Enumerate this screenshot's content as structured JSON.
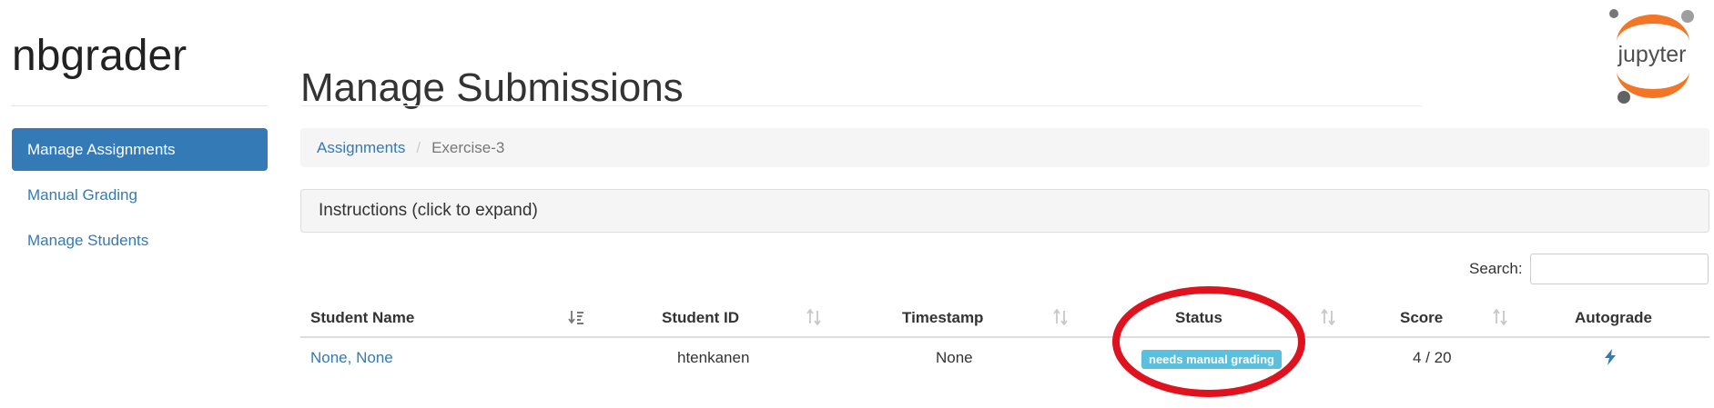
{
  "sidebar": {
    "brand": "nbgrader",
    "items": [
      {
        "label": "Manage Assignments",
        "active": true
      },
      {
        "label": "Manual Grading",
        "active": false
      },
      {
        "label": "Manage Students",
        "active": false
      }
    ]
  },
  "header": {
    "title": "Manage Submissions",
    "logo_text": "jupyter"
  },
  "breadcrumb": {
    "items": [
      "Assignments",
      "Exercise-3"
    ],
    "separator": "/"
  },
  "instructions": {
    "label": "Instructions (click to expand)"
  },
  "search": {
    "label": "Search:",
    "value": "",
    "placeholder": ""
  },
  "table": {
    "columns": [
      "Student Name",
      "Student ID",
      "Timestamp",
      "Status",
      "Score",
      "Autograde"
    ],
    "rows": [
      {
        "student_name": "None, None",
        "student_id": "htenkanen",
        "timestamp": "None",
        "status": "needs manual grading",
        "score": "4 / 20",
        "autograde_icon": "bolt-icon"
      }
    ]
  },
  "colors": {
    "link": "#337ab7",
    "active_nav_bg": "#337ab7",
    "status_badge": "#5bc0de",
    "annotation_circle": "#e0121e",
    "logo_orange": "#f37626"
  }
}
